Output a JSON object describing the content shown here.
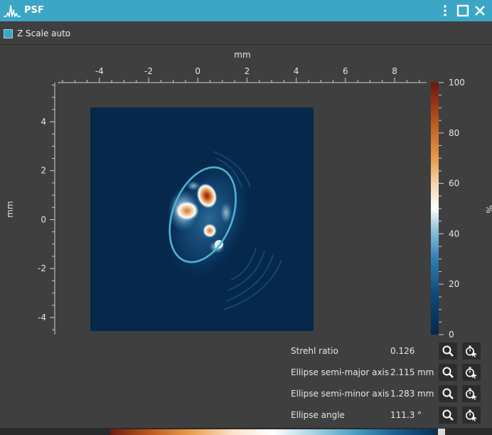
{
  "window": {
    "title": "PSF",
    "icons": [
      "psf-signal-icon",
      "vertical-dots-menu-icon",
      "maximize-icon",
      "close-icon"
    ]
  },
  "toolbar": {
    "z_scale_label": "Z Scale auto",
    "z_scale_checked": true
  },
  "plot": {
    "x_axis_label": "mm",
    "y_axis_label": "mm",
    "colorbar_label": "%",
    "x_ticks": [
      "-4",
      "-2",
      "0",
      "2",
      "4",
      "6",
      "8"
    ],
    "y_ticks": [
      "4",
      "2",
      "0",
      "-2",
      "-4"
    ],
    "colorbar_ticks": [
      "100",
      "80",
      "60",
      "40",
      "20",
      "0"
    ],
    "x_range": [
      -5.7,
      9.3
    ],
    "y_range": [
      -4.7,
      5.6
    ],
    "colorbar_range": [
      0,
      100
    ],
    "image_extent_mm": {
      "x": [
        -4.6,
        4.5
      ],
      "y": [
        -4.5,
        4.5
      ]
    },
    "ellipse": {
      "center_mm": [
        0.2,
        0.2
      ],
      "semi_major_mm": 2.115,
      "semi_minor_mm": 1.283,
      "angle_deg": 111.3
    },
    "colors": {
      "background": "#05284b",
      "ellipse": "#4fb3d4",
      "accent": "#3ba6c6"
    }
  },
  "metrics": [
    {
      "label": "Strehl ratio",
      "value": "0.126",
      "unit": ""
    },
    {
      "label": "Ellipse semi-major axis",
      "value": "2.115",
      "unit": "mm"
    },
    {
      "label": "Ellipse semi-minor axis",
      "value": "1.283",
      "unit": "mm"
    },
    {
      "label": "Ellipse angle",
      "value": "111.3",
      "unit": "°"
    }
  ]
}
